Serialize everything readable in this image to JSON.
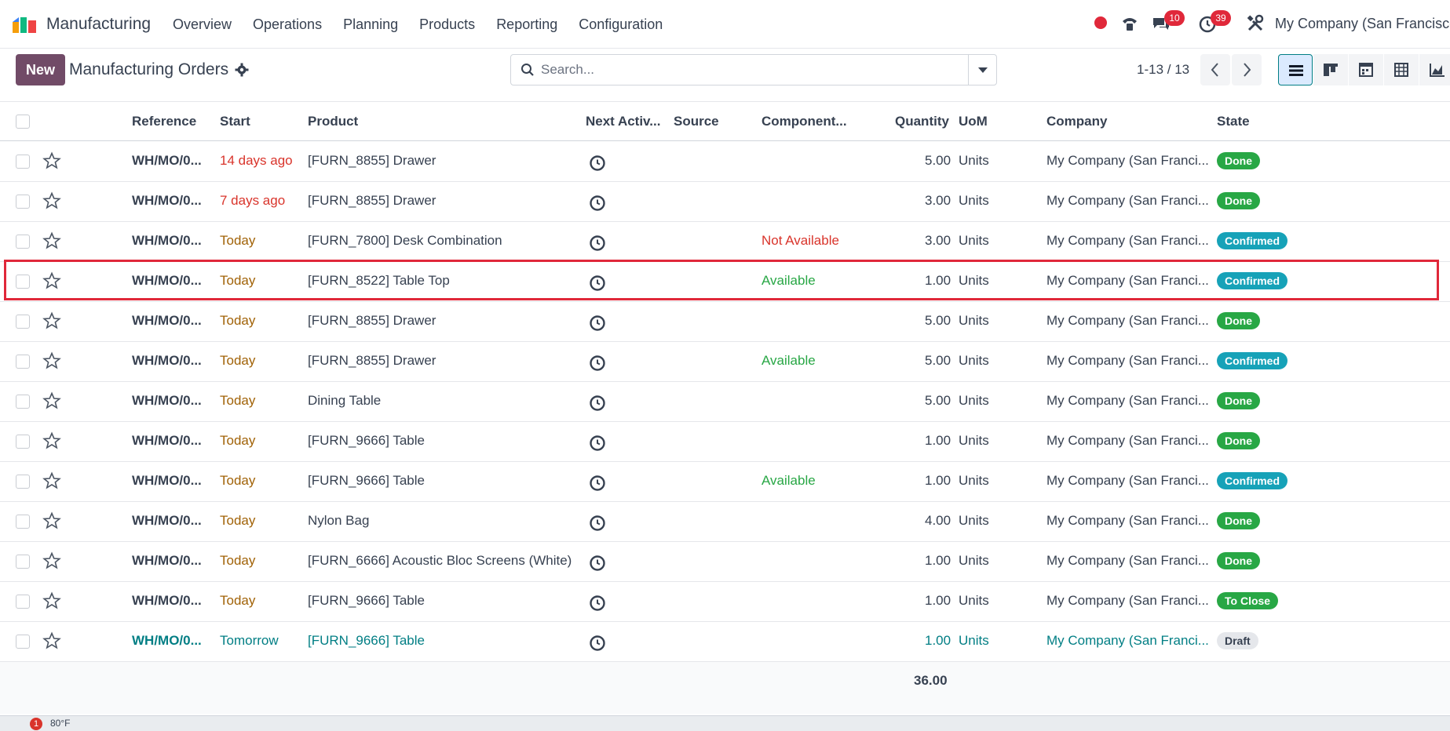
{
  "navbar": {
    "app_name": "Manufacturing",
    "menu": [
      "Overview",
      "Operations",
      "Planning",
      "Products",
      "Reporting",
      "Configuration"
    ],
    "messages_badge": "10",
    "activities_badge": "39",
    "company": "My Company (San Francisco)"
  },
  "control": {
    "new_label": "New",
    "title": "Manufacturing Orders",
    "search_placeholder": "Search...",
    "pager": "1-13 / 13"
  },
  "table": {
    "headers": {
      "reference": "Reference",
      "start": "Start",
      "product": "Product",
      "next_activity": "Next Activ...",
      "source": "Source",
      "component": "Component...",
      "quantity": "Quantity",
      "uom": "UoM",
      "company": "Company",
      "state": "State"
    },
    "rows": [
      {
        "ref": "WH/MO/0...",
        "start": "14 days ago",
        "start_kind": "late",
        "product": "[FURN_8855] Drawer",
        "component": "",
        "comp_kind": "",
        "qty": "5.00",
        "uom": "Units",
        "company": "My Company (San Franci...",
        "state": "Done",
        "state_kind": "done"
      },
      {
        "ref": "WH/MO/0...",
        "start": "7 days ago",
        "start_kind": "late",
        "product": "[FURN_8855] Drawer",
        "component": "",
        "comp_kind": "",
        "qty": "3.00",
        "uom": "Units",
        "company": "My Company (San Franci...",
        "state": "Done",
        "state_kind": "done"
      },
      {
        "ref": "WH/MO/0...",
        "start": "Today",
        "start_kind": "today",
        "product": "[FURN_7800] Desk Combination",
        "component": "Not Available",
        "comp_kind": "navail",
        "qty": "3.00",
        "uom": "Units",
        "company": "My Company (San Franci...",
        "state": "Confirmed",
        "state_kind": "confirmed"
      },
      {
        "ref": "WH/MO/0...",
        "start": "Today",
        "start_kind": "today",
        "product": "[FURN_8522] Table Top",
        "component": "Available",
        "comp_kind": "avail",
        "qty": "1.00",
        "uom": "Units",
        "company": "My Company (San Franci...",
        "state": "Confirmed",
        "state_kind": "confirmed"
      },
      {
        "ref": "WH/MO/0...",
        "start": "Today",
        "start_kind": "today",
        "product": "[FURN_8855] Drawer",
        "component": "",
        "comp_kind": "",
        "qty": "5.00",
        "uom": "Units",
        "company": "My Company (San Franci...",
        "state": "Done",
        "state_kind": "done"
      },
      {
        "ref": "WH/MO/0...",
        "start": "Today",
        "start_kind": "today",
        "product": "[FURN_8855] Drawer",
        "component": "Available",
        "comp_kind": "avail",
        "qty": "5.00",
        "uom": "Units",
        "company": "My Company (San Franci...",
        "state": "Confirmed",
        "state_kind": "confirmed"
      },
      {
        "ref": "WH/MO/0...",
        "start": "Today",
        "start_kind": "today",
        "product": "Dining Table",
        "component": "",
        "comp_kind": "",
        "qty": "5.00",
        "uom": "Units",
        "company": "My Company (San Franci...",
        "state": "Done",
        "state_kind": "done"
      },
      {
        "ref": "WH/MO/0...",
        "start": "Today",
        "start_kind": "today",
        "product": "[FURN_9666] Table",
        "component": "",
        "comp_kind": "",
        "qty": "1.00",
        "uom": "Units",
        "company": "My Company (San Franci...",
        "state": "Done",
        "state_kind": "done"
      },
      {
        "ref": "WH/MO/0...",
        "start": "Today",
        "start_kind": "today",
        "product": "[FURN_9666] Table",
        "component": "Available",
        "comp_kind": "avail",
        "qty": "1.00",
        "uom": "Units",
        "company": "My Company (San Franci...",
        "state": "Confirmed",
        "state_kind": "confirmed"
      },
      {
        "ref": "WH/MO/0...",
        "start": "Today",
        "start_kind": "today",
        "product": "Nylon Bag",
        "component": "",
        "comp_kind": "",
        "qty": "4.00",
        "uom": "Units",
        "company": "My Company (San Franci...",
        "state": "Done",
        "state_kind": "done"
      },
      {
        "ref": "WH/MO/0...",
        "start": "Today",
        "start_kind": "today",
        "product": "[FURN_6666] Acoustic Bloc Screens (White)",
        "component": "",
        "comp_kind": "",
        "qty": "1.00",
        "uom": "Units",
        "company": "My Company (San Franci...",
        "state": "Done",
        "state_kind": "done"
      },
      {
        "ref": "WH/MO/0...",
        "start": "Today",
        "start_kind": "today",
        "product": "[FURN_9666] Table",
        "component": "",
        "comp_kind": "",
        "qty": "1.00",
        "uom": "Units",
        "company": "My Company (San Franci...",
        "state": "To Close",
        "state_kind": "toclose"
      },
      {
        "ref": "WH/MO/0...",
        "start": "Tomorrow",
        "start_kind": "future",
        "product": "[FURN_9666] Table",
        "component": "",
        "comp_kind": "",
        "qty": "1.00",
        "uom": "Units",
        "company": "My Company (San Franci...",
        "state": "Draft",
        "state_kind": "draft"
      }
    ],
    "total_qty": "36.00"
  },
  "taskbar": {
    "weather_badge": "1",
    "weather": "80°F"
  }
}
